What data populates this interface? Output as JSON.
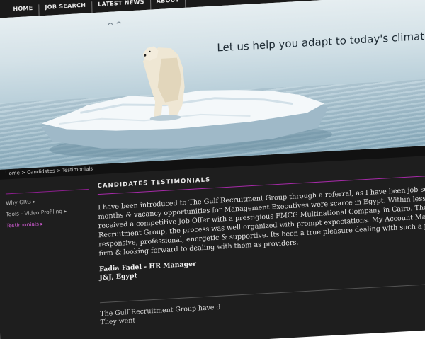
{
  "nav": {
    "items": [
      "HOME",
      "JOB SEARCH",
      "LATEST NEWS",
      "ABOUT"
    ]
  },
  "hero": {
    "tagline": "Let us help you adapt to today's climate"
  },
  "breadcrumb": "Home > Candidates > Testimonials",
  "sidebar": {
    "items": [
      {
        "label": "Why GRG ▸"
      },
      {
        "label": "Tools - Video Profiling ▸"
      },
      {
        "label": "Testimonials ▸"
      }
    ]
  },
  "main": {
    "title": "CANDIDATES TESTIMONIALS",
    "testimonial1": {
      "lines": [
        "I have been introduced to The Gulf Recruitment Group through a referral, as I have been job searching f",
        "months & vacancy opportunities for Management Executives were scarce in Egypt. Within less than two v",
        "received a competitive Job Offer with a prestigious FMCG Multinational Company in Cairo. Thanks to The",
        "Recruitment Group, the process was well organized with prompt expectations. My Account Manager was",
        "responsive, professional, energetic & supportive. Its been a true pleasure dealing with such a professiona",
        "firm & looking forward to dealing with them as providers."
      ],
      "author": "Fadia Fadel - HR Manager",
      "company": "J&J, Egypt"
    },
    "testimonial2": {
      "lines": [
        "The Gulf Recruitment Group have d",
        "They went"
      ]
    }
  },
  "colors": {
    "accent": "#a62aa8",
    "active_link": "#d45cd6",
    "background_dark": "#1e1e1e"
  }
}
